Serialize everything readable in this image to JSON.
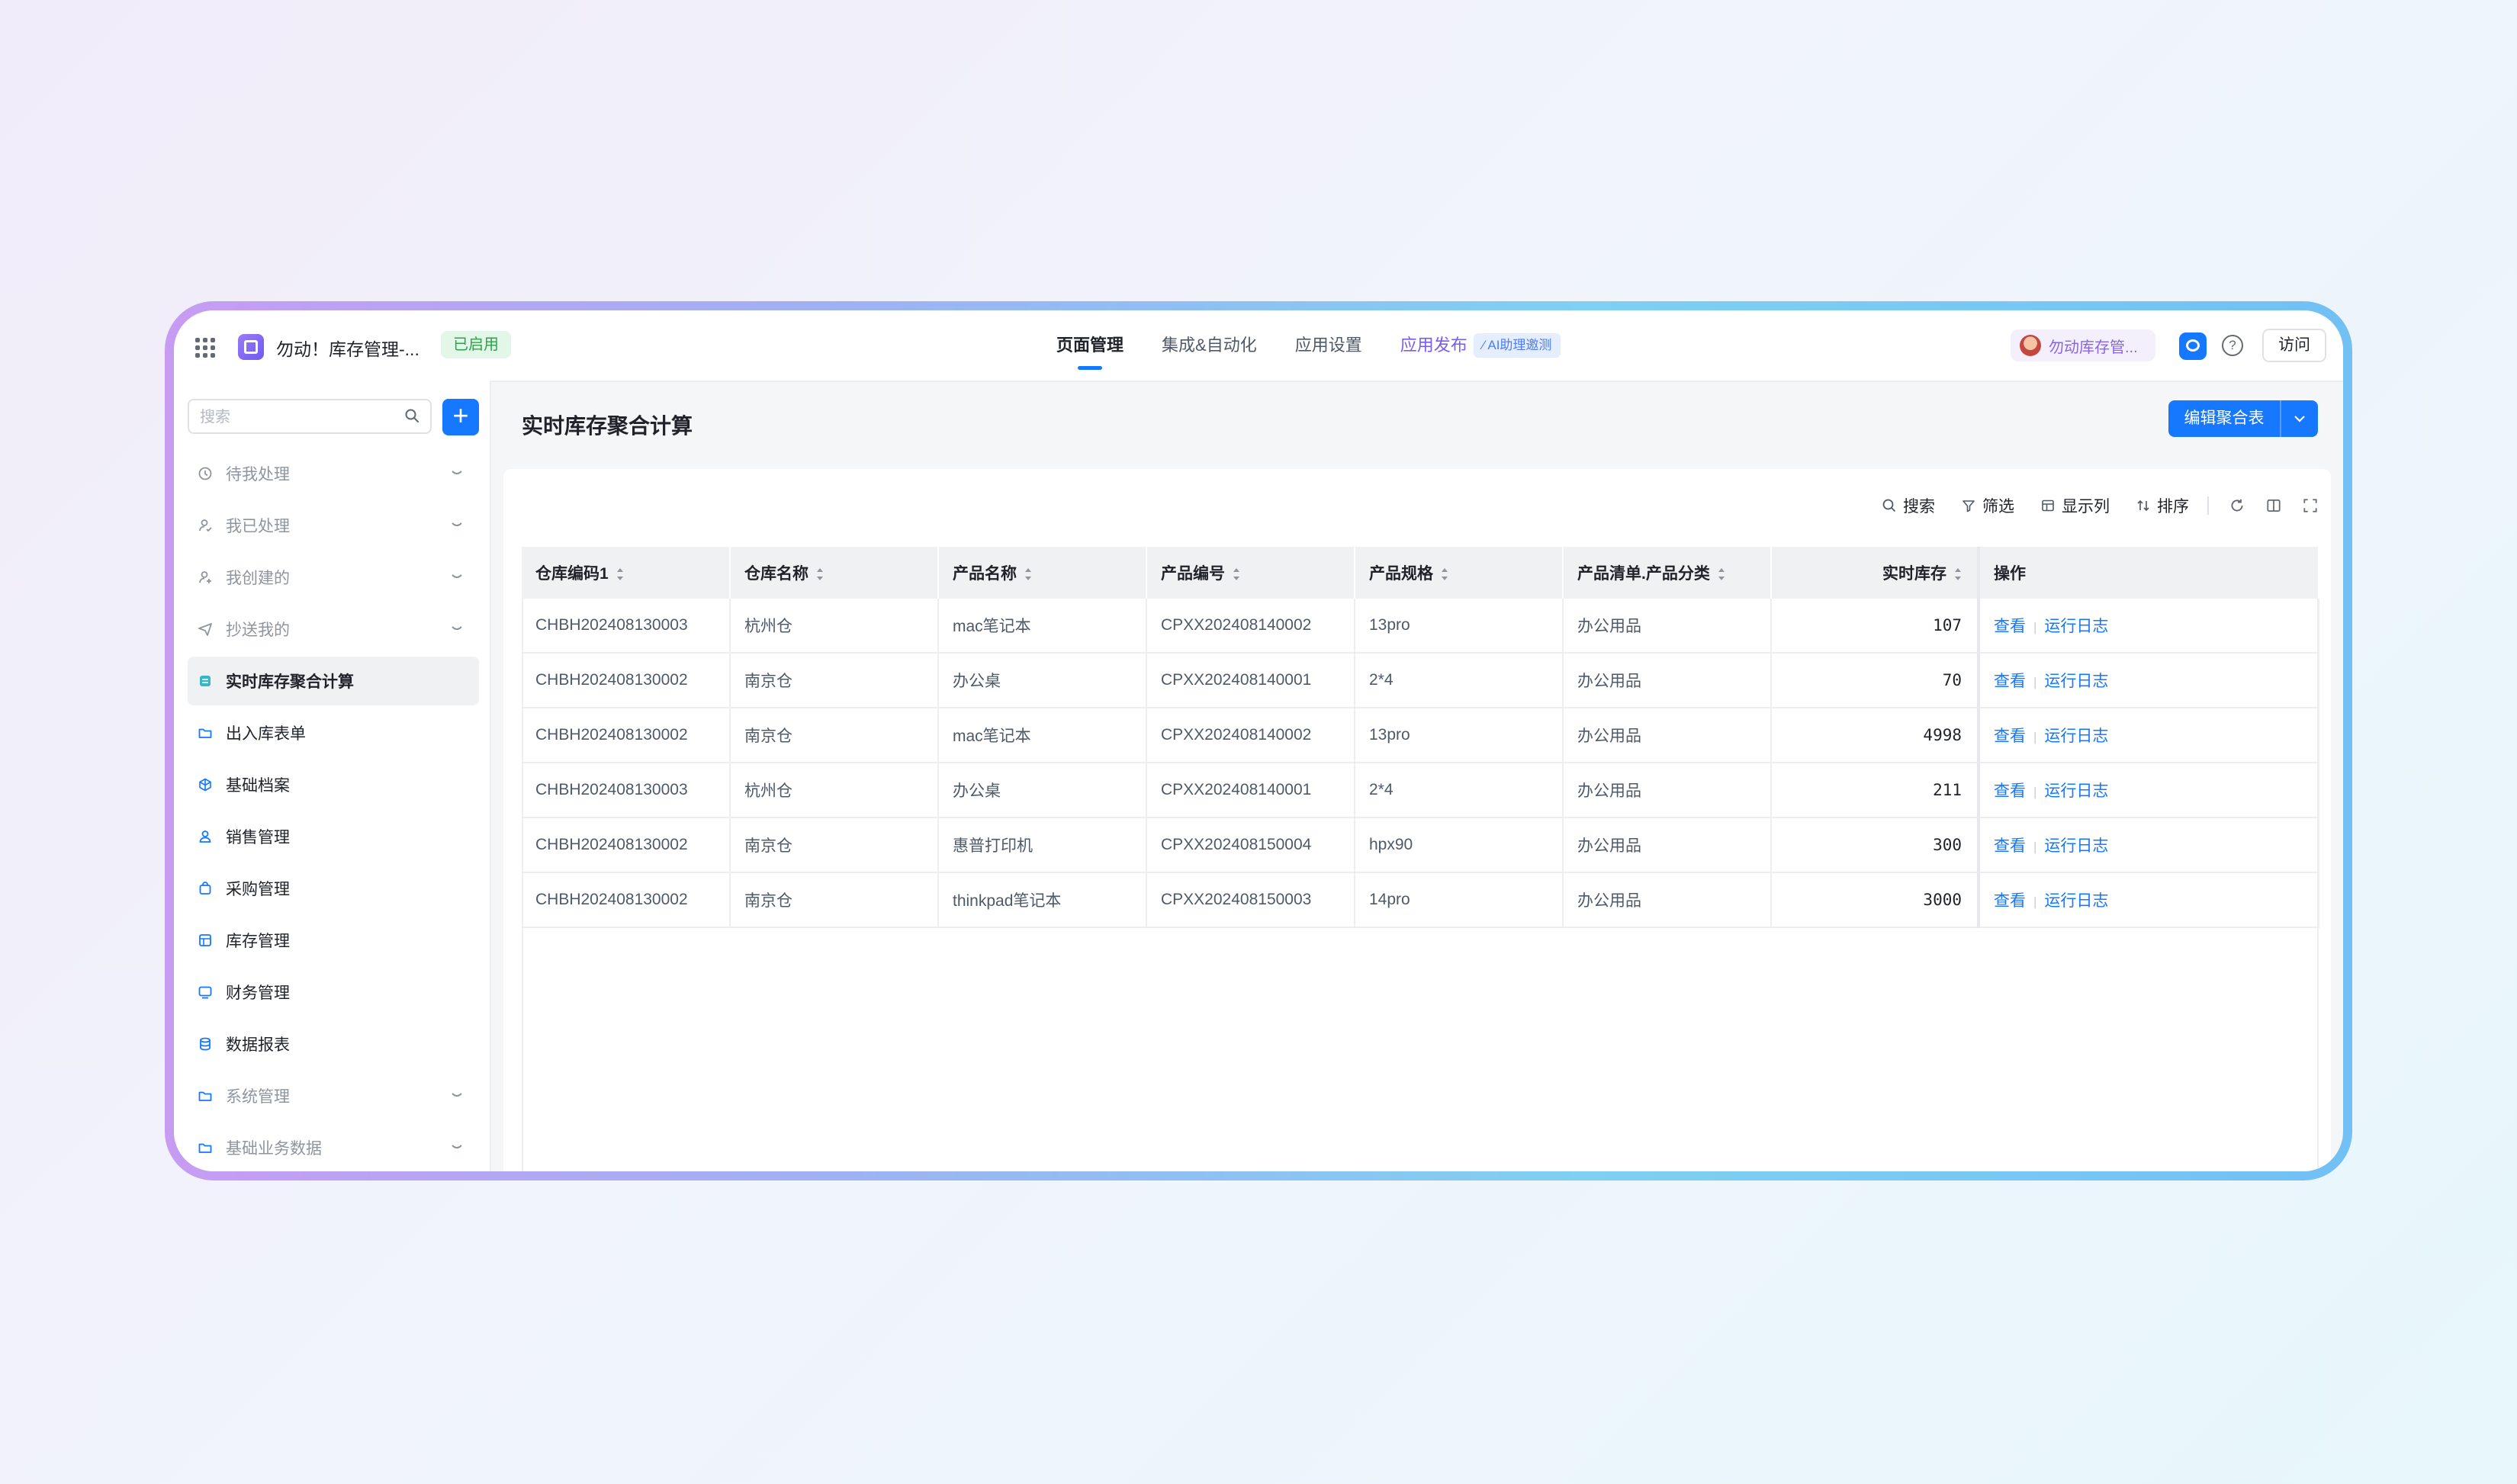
{
  "topbar": {
    "app_title": "勿动！库存管理-...",
    "status": "已启用",
    "nav": [
      "页面管理",
      "集成&自动化",
      "应用设置"
    ],
    "publish": "应用发布",
    "ai_badge": "AI助理邀测",
    "user_name": "勿动库存管...",
    "help": "?",
    "visit": "访问"
  },
  "sidebar": {
    "search_placeholder": "搜索",
    "add": "+",
    "items": [
      {
        "label": "待我处理"
      },
      {
        "label": "我已处理"
      },
      {
        "label": "我创建的"
      },
      {
        "label": "抄送我的"
      },
      {
        "label": "实时库存聚合计算"
      },
      {
        "label": "出入库表单"
      },
      {
        "label": "基础档案"
      },
      {
        "label": "销售管理"
      },
      {
        "label": "采购管理"
      },
      {
        "label": "库存管理"
      },
      {
        "label": "财务管理"
      },
      {
        "label": "数据报表"
      },
      {
        "label": "系统管理"
      },
      {
        "label": "基础业务数据"
      }
    ]
  },
  "main": {
    "title": "实时库存聚合计算",
    "edit_button": "编辑聚合表",
    "toolbar": {
      "search": "搜索",
      "filter": "筛选",
      "columns": "显示列",
      "sort": "排序"
    },
    "columns": [
      "仓库编码1",
      "仓库名称",
      "产品名称",
      "产品编号",
      "产品规格",
      "产品清单.产品分类",
      "实时库存",
      "操作"
    ],
    "rows": [
      [
        "CHBH202408130003",
        "杭州仓",
        "mac笔记本",
        "CPXX202408140002",
        "13pro",
        "办公用品",
        "107"
      ],
      [
        "CHBH202408130002",
        "南京仓",
        "办公桌",
        "CPXX202408140001",
        "2*4",
        "办公用品",
        "70"
      ],
      [
        "CHBH202408130002",
        "南京仓",
        "mac笔记本",
        "CPXX202408140002",
        "13pro",
        "办公用品",
        "4998"
      ],
      [
        "CHBH202408130003",
        "杭州仓",
        "办公桌",
        "CPXX202408140001",
        "2*4",
        "办公用品",
        "211"
      ],
      [
        "CHBH202408130002",
        "南京仓",
        "惠普打印机",
        "CPXX202408150004",
        "hpx90",
        "办公用品",
        "300"
      ],
      [
        "CHBH202408130002",
        "南京仓",
        "thinkpad笔记本",
        "CPXX202408150003",
        "14pro",
        "办公用品",
        "3000"
      ]
    ],
    "action_view": "查看",
    "action_sep": "|",
    "action_log": "运行日志"
  },
  "colors": {
    "accent": "#1677ff",
    "success": "#2ea24a",
    "frame_start": "#c79cf2",
    "frame_end": "#72c0f4"
  }
}
